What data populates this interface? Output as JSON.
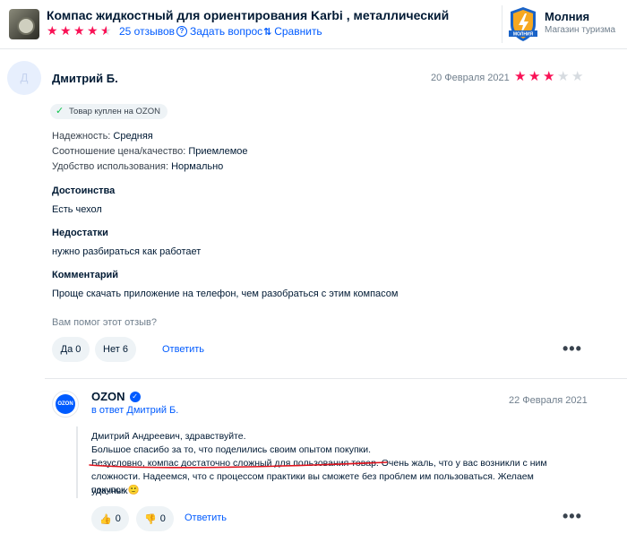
{
  "product": {
    "title": "Компас жидкостный для ориентирования Karbi , металлический",
    "rating_stars": 4.5,
    "reviews_link": "25 отзывов",
    "ask_link": "Задать вопрос",
    "compare_link": "Сравнить"
  },
  "shop": {
    "name": "Молния",
    "subtitle": "Магазин туризма",
    "logo_text": "МОЛНИЯ"
  },
  "review": {
    "avatar_letter": "Д",
    "author": "Дмитрий Б.",
    "date": "20 Февраля 2021",
    "rating": 3,
    "max_rating": 5,
    "badge": "Товар куплен на OZON",
    "params": [
      {
        "key": "Надежность:",
        "value": "Средняя"
      },
      {
        "key": "Соотношение цена/качество:",
        "value": "Приемлемое"
      },
      {
        "key": "Удобство использования:",
        "value": "Нормально"
      }
    ],
    "pros_title": "Достоинства",
    "pros_text": "Есть чехол",
    "cons_title": "Недостатки",
    "cons_text": "нужно разбираться как работает",
    "comment_title": "Комментарий",
    "comment_text": "Проще скачать приложение на телефон, чем разобраться с этим компасом",
    "helpful_question": "Вам помог этот отзыв?",
    "yes_label": "Да 0",
    "no_label": "Нет 6",
    "answer_label": "Ответить",
    "more_label": "•••"
  },
  "reply": {
    "logo_text": "OZON",
    "author": "OZON",
    "verified_icon": "✓",
    "reply_to": "в ответ Дмитрий Б.",
    "date": "22 Февраля 2021",
    "lines": [
      "Дмитрий Андреевич, здравствуйте.",
      "Большое спасибо за то, что поделились своим опытом покупки.",
      "Безусловно, компас достаточно сложный для пользования товар. Очень жаль, что у вас возникли с ним",
      "сложности. Надеемся, что с процессом практики вы сможете без проблем им пользоваться. Желаем удачных",
      "покупок 🙂"
    ],
    "like_count": "0",
    "dislike_count": "0",
    "answer_label": "Ответить",
    "more_label": "•••"
  },
  "colors": {
    "accent": "#005bff",
    "star": "#f91155",
    "check": "#10c44c",
    "underline": "#e0141e"
  }
}
